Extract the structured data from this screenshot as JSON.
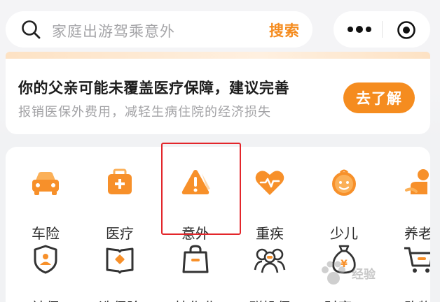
{
  "search": {
    "placeholder": "家庭出游驾乘意外",
    "button_label": "搜索",
    "icon": "search-icon"
  },
  "capsule": {
    "more_icon": "more-dots-icon",
    "close_icon": "target-close-icon"
  },
  "notice": {
    "title": "你的父亲可能未覆盖医疗保障，建议完善",
    "subtitle": "报销医保外费用，减轻生病住院的经济损失",
    "cta_label": "去了解"
  },
  "categories_row1": [
    {
      "label": "车险",
      "icon": "car-icon"
    },
    {
      "label": "医疗",
      "icon": "medical-kit-icon"
    },
    {
      "label": "意外",
      "icon": "warning-icon"
    },
    {
      "label": "重疾",
      "icon": "heart-pulse-icon"
    },
    {
      "label": "少儿",
      "icon": "child-face-icon"
    },
    {
      "label": "养老",
      "icon": "elderly-care-icon"
    }
  ],
  "categories_row2": [
    {
      "label": "社保",
      "icon": "social-security-icon"
    },
    {
      "label": "选保险",
      "icon": "book-icon"
    },
    {
      "label": "抄作业",
      "icon": "bag-icon"
    },
    {
      "label": "群投保",
      "icon": "group-icon"
    },
    {
      "label": "财富+",
      "icon": "money-bag-icon"
    },
    {
      "label": "购物",
      "icon": "cart-icon"
    }
  ],
  "colors": {
    "accent": "#f58c1f",
    "highlight_box": "#e3262b"
  },
  "watermark": {
    "text": "经验"
  }
}
